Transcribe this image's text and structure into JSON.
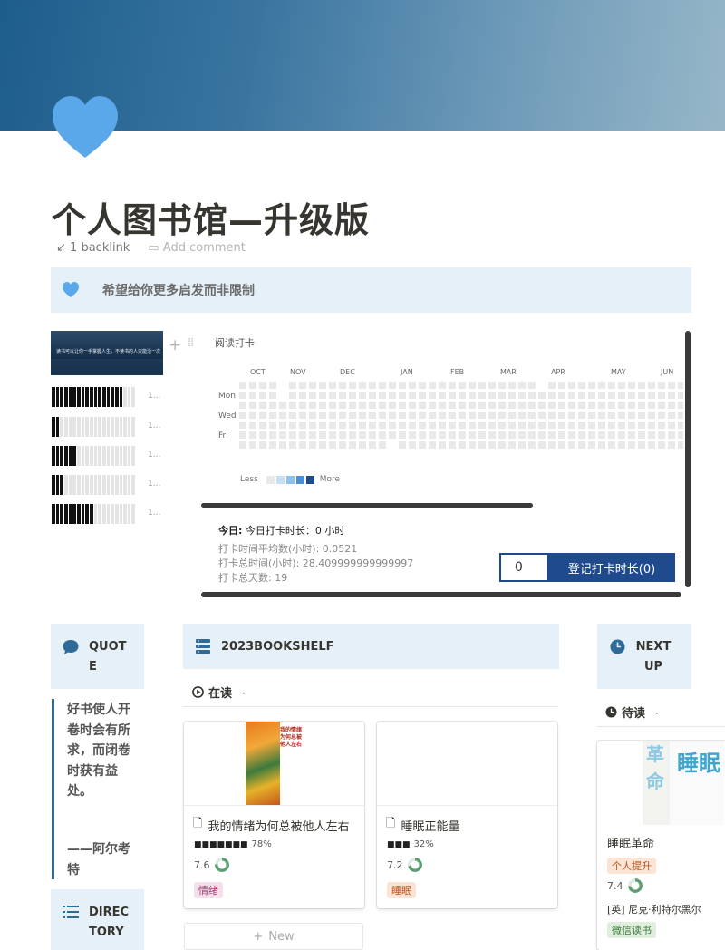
{
  "page": {
    "title": "个人图书馆—升级版",
    "backlink": "1 backlink",
    "add_comment": "Add comment",
    "callout": "希望给你更多启发而非限制",
    "cover_colors": [
      "#1d5d8c",
      "#97b7c8"
    ],
    "heart_color": "#5aa7ea"
  },
  "media": {
    "image_caption": "读书可以让你一手掌握人生，不读书的人只能活一次",
    "progress_bars": [
      {
        "filled": 17,
        "total": 20,
        "label": "1..."
      },
      {
        "filled": 2,
        "total": 20,
        "label": "1..."
      },
      {
        "filled": 6,
        "total": 20,
        "label": "1..."
      },
      {
        "filled": 3,
        "total": 20,
        "label": "1..."
      },
      {
        "filled": 10,
        "total": 20,
        "label": "1..."
      }
    ]
  },
  "heatmap": {
    "title": "阅读打卡",
    "months": [
      "OCT",
      "NOV",
      "DEC",
      "JAN",
      "FEB",
      "MAR",
      "APR",
      "MAY",
      "JUN"
    ],
    "days": [
      "Mon",
      "Wed",
      "Fri"
    ],
    "legend_less": "Less",
    "legend_more": "More",
    "legend_colors": [
      "#e9e9e9",
      "#c6dff4",
      "#8ec0ec",
      "#4a8fd8",
      "#1f4a8d"
    ],
    "today_label": "今日:",
    "today_text": "今日打卡时长：0 小时",
    "stats": [
      "打卡时间平均数(小时): 0.0521",
      "打卡总时间(小时): 28.409999999999997",
      "打卡总天数: 19"
    ],
    "input_value": "0",
    "submit_label": "登记打卡时长(0)",
    "accent": "#1f4a8d"
  },
  "quote": {
    "label": "QUOTE",
    "text": "好书使人开卷时会有所求，而闭卷时获有益处。",
    "author": "——阿尔考特"
  },
  "directory": {
    "label": "DIRECTORY"
  },
  "bookshelf": {
    "label": "2023BOOKSHELF",
    "view": "在读",
    "new_label": "New",
    "cards": [
      {
        "title": "我的情绪为何总被他人左右",
        "progress_blocks": "■■■■■■■",
        "progress": "78%",
        "score": "7.6",
        "score_frac": 0.76,
        "tag": "情绪",
        "tag_color": "#f4dfeb",
        "tag_text_color": "#a63c72",
        "cover_text": "我的情绪为何总被他人左右"
      },
      {
        "title": "睡眠正能量",
        "progress_blocks": "■■■",
        "progress": "32%",
        "score": "7.2",
        "score_frac": 0.72,
        "tag": "睡眠",
        "tag_color": "#fbe4d3",
        "tag_text_color": "#b8541d"
      }
    ]
  },
  "next_up": {
    "label": "NEXT UP",
    "view": "待读",
    "card": {
      "title": "睡眠革命",
      "tag1": "个人提升",
      "score": "7.4",
      "score_frac": 0.74,
      "author": "[英] 尼克·利特尔黑尔",
      "tag2": "微信读书",
      "cover_text1": "革命",
      "cover_text2": "睡眠"
    }
  }
}
